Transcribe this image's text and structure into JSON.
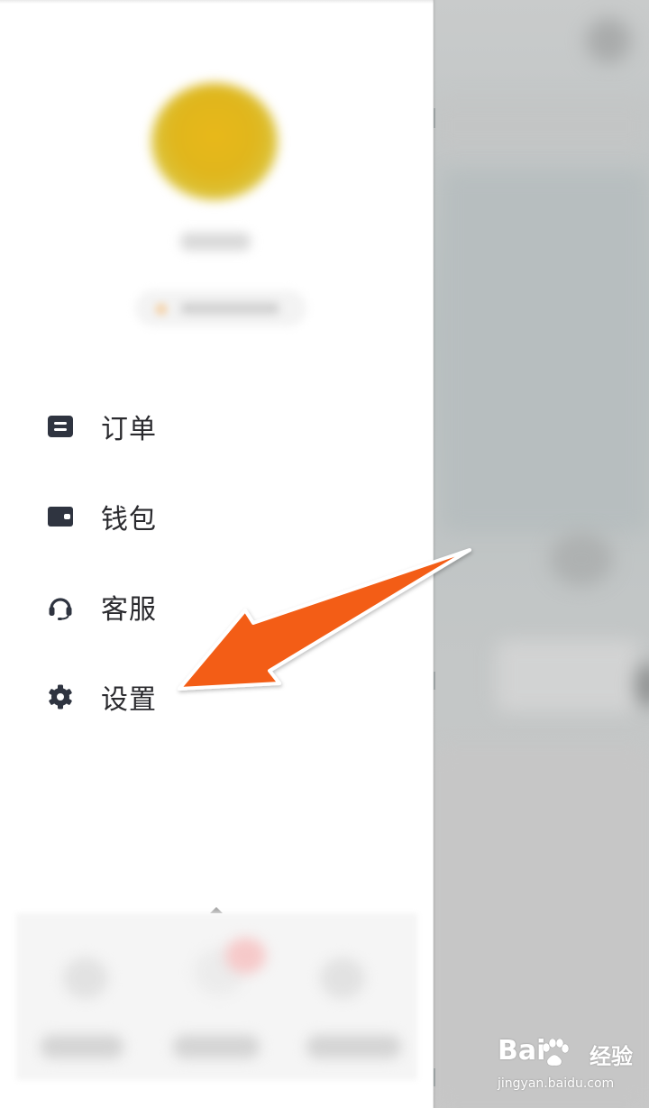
{
  "menu": {
    "items": [
      {
        "label": "订单",
        "icon": "order-list-icon"
      },
      {
        "label": "钱包",
        "icon": "wallet-icon"
      },
      {
        "label": "客服",
        "icon": "headset-icon"
      },
      {
        "label": "设置",
        "icon": "gear-icon"
      }
    ]
  },
  "annotation": {
    "arrow_color": "#f35d14",
    "arrow_target": "设置"
  },
  "watermark": {
    "brand": "Bai",
    "brand_suffix": "经验",
    "url": "jingyan.baidu.com"
  },
  "colors": {
    "menu_icon": "#2f3440",
    "menu_text": "#2a2a2e",
    "avatar": "#e3b51b",
    "overlay": "#c2c6c6"
  }
}
